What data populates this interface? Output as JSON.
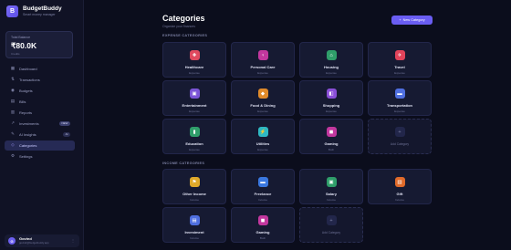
{
  "brand": {
    "name": "BudgetBuddy",
    "tagline": "Smart money manager",
    "logo_letter": "B"
  },
  "balance": {
    "label": "Total Balance",
    "amount": "₹80.0K",
    "sub": "Credits"
  },
  "nav": [
    {
      "label": "Dashboard",
      "icon": "dashboard-icon",
      "glyph": "▦"
    },
    {
      "label": "Transactions",
      "icon": "transactions-icon",
      "glyph": "⇅"
    },
    {
      "label": "Budgets",
      "icon": "budgets-icon",
      "glyph": "◉"
    },
    {
      "label": "Bills",
      "icon": "bills-icon",
      "glyph": "▤"
    },
    {
      "label": "Reports",
      "icon": "reports-icon",
      "glyph": "▥"
    },
    {
      "label": "Investments",
      "icon": "investments-icon",
      "glyph": "↗",
      "badge": "NEW"
    },
    {
      "label": "AI Insights",
      "icon": "ai-insights-icon",
      "glyph": "✎",
      "badge": "AI"
    },
    {
      "label": "Categories",
      "icon": "categories-icon",
      "glyph": "◇",
      "active": true
    },
    {
      "label": "Settings",
      "icon": "settings-icon",
      "glyph": "⚙"
    }
  ],
  "user": {
    "initial": "G",
    "name": "Govind",
    "email": "govind@budgetbuddy.app",
    "menu": "⋮"
  },
  "page": {
    "title": "Categories",
    "subtitle": "Organize your finances"
  },
  "new_button": {
    "plus": "+",
    "label": "New Category"
  },
  "sections": {
    "expense_label": "EXPENSE CATEGORIES",
    "income_label": "INCOME CATEGORIES"
  },
  "expense_categories": [
    {
      "name": "Healthcare",
      "type": "Expense",
      "icon": "healthcare-icon",
      "glyph": "✚",
      "color": "#e04a5f"
    },
    {
      "name": "Personal Care",
      "type": "Expense",
      "icon": "personal-care-icon",
      "glyph": "♀",
      "color": "#c2379e"
    },
    {
      "name": "Housing",
      "type": "Expense",
      "icon": "housing-icon",
      "glyph": "⌂",
      "color": "#2f9e6a"
    },
    {
      "name": "Travel",
      "type": "Expense",
      "icon": "travel-icon",
      "glyph": "✈",
      "color": "#e0435a"
    },
    {
      "name": "Entertainment",
      "type": "Expense",
      "icon": "entertainment-icon",
      "glyph": "▣",
      "color": "#7b55d6"
    },
    {
      "name": "Food & Dining",
      "type": "Expense",
      "icon": "food-icon",
      "glyph": "◆",
      "color": "#e08a2a"
    },
    {
      "name": "Shopping",
      "type": "Expense",
      "icon": "shopping-icon",
      "glyph": "◧",
      "color": "#8a4fd8"
    },
    {
      "name": "Transportation",
      "type": "Expense",
      "icon": "transportation-icon",
      "glyph": "▬",
      "color": "#4f6fe0"
    },
    {
      "name": "Education",
      "type": "Expense",
      "icon": "education-icon",
      "glyph": "▮",
      "color": "#2f9e6a"
    },
    {
      "name": "Utilities",
      "type": "Expense",
      "icon": "utilities-icon",
      "glyph": "⚡",
      "color": "#2fb8c2"
    },
    {
      "name": "Gaming",
      "type": "Both",
      "icon": "gaming-icon",
      "glyph": "◼",
      "color": "#c2379e"
    }
  ],
  "income_categories": [
    {
      "name": "Other Income",
      "type": "Income",
      "icon": "other-income-icon",
      "glyph": "⚑",
      "color": "#e0a92a"
    },
    {
      "name": "Freelance",
      "type": "Income",
      "icon": "freelance-icon",
      "glyph": "▬",
      "color": "#3a78e0"
    },
    {
      "name": "Salary",
      "type": "Income",
      "icon": "salary-icon",
      "glyph": "▣",
      "color": "#2f9e6a"
    },
    {
      "name": "Gift",
      "type": "Income",
      "icon": "gift-icon",
      "glyph": "▥",
      "color": "#e06a2a"
    },
    {
      "name": "Investment",
      "type": "Income",
      "icon": "investment-icon",
      "glyph": "▤",
      "color": "#4f6fe0"
    },
    {
      "name": "Gaming",
      "type": "Both",
      "icon": "gaming-icon",
      "glyph": "◼",
      "color": "#c2379e"
    }
  ],
  "add_card": {
    "glyph": "+",
    "label": "Add Category"
  },
  "colors": {
    "background": "#0b0d1c",
    "sidebar": "#101225",
    "card": "#161a32",
    "accent": "#6a5df2",
    "active_nav": "#262a55"
  }
}
